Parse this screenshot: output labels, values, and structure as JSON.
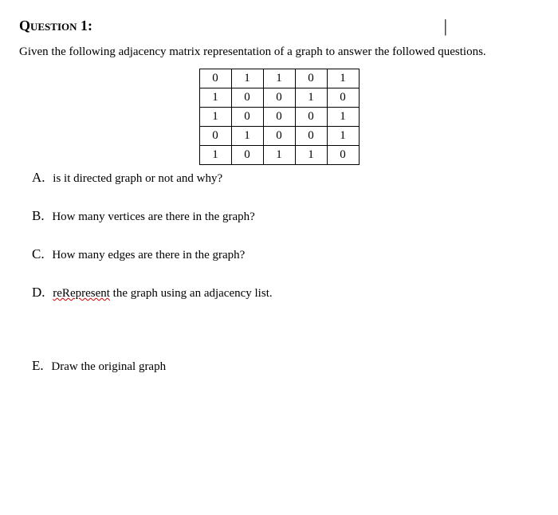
{
  "title": "Question 1:",
  "cursor": "|",
  "intro": "Given the following adjacency matrix representation of a graph to answer the followed questions.",
  "matrix": [
    [
      "0",
      "1",
      "1",
      "0",
      "1"
    ],
    [
      "1",
      "0",
      "0",
      "1",
      "0"
    ],
    [
      "1",
      "0",
      "0",
      "0",
      "1"
    ],
    [
      "0",
      "1",
      "0",
      "0",
      "1"
    ],
    [
      "1",
      "0",
      "1",
      "1",
      "0"
    ]
  ],
  "parts": {
    "A": {
      "label": "A.",
      "text": "is it directed graph or not and why?"
    },
    "B": {
      "label": "B.",
      "text": "How many vertices are there in the graph?"
    },
    "C": {
      "label": "C.",
      "text": "How many edges are there in the graph?"
    },
    "D": {
      "label": "D.",
      "word": "reRepresent",
      "rest": " the graph using an adjacency list."
    },
    "E": {
      "label": "E.",
      "text": "Draw the original graph"
    }
  }
}
